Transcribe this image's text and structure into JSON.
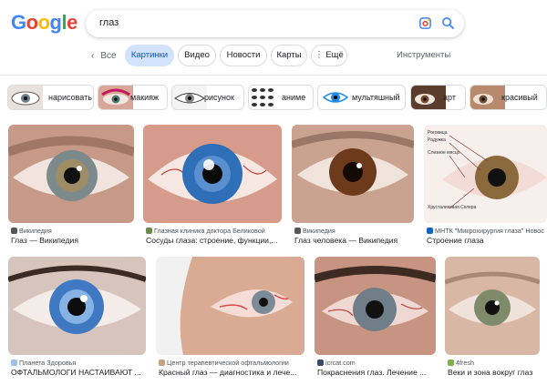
{
  "logo": "Google",
  "search": {
    "query": "глаз"
  },
  "tabs": {
    "back": "Все",
    "items": [
      "Картинки",
      "Видео",
      "Новости",
      "Карты",
      "Ещё"
    ],
    "tools": "Инструменты"
  },
  "chips": [
    "нарисовать",
    "макияж",
    "рисунок",
    "аниме",
    "мультяшный",
    "арт",
    "красивый"
  ],
  "results": [
    {
      "source": "Википедия",
      "title": "Глаз — Википедия"
    },
    {
      "source": "Глазная клиника доктора Беликовой",
      "title": "Сосуды глаза: строение, функции,..."
    },
    {
      "source": "Википедия",
      "title": "Глаз человека — Википедия"
    },
    {
      "source": "МНТК \"Микрохирургия глаза\" Новос",
      "title": "Строение глаза"
    },
    {
      "source": "Планета Здоровья",
      "title": "ОФТАЛЬМОЛОГИ НАСТАИВАЮТ ..."
    },
    {
      "source": "Центр терапевтической офтальмологии",
      "title": "Красный глаз — диагностика и лече..."
    },
    {
      "source": "icrcat.com",
      "title": "Покраснения глаз. Лечение ..."
    },
    {
      "source": "4fresh",
      "title": "Веки и зона вокруг глаз"
    }
  ],
  "anatomy_labels": [
    "Роговица",
    "Радужка",
    "Слезное мясцо",
    "Хрусталиковая Склера"
  ],
  "colors": {
    "accent": "#0b57d0",
    "active_tab_bg": "#d3e3fd"
  }
}
